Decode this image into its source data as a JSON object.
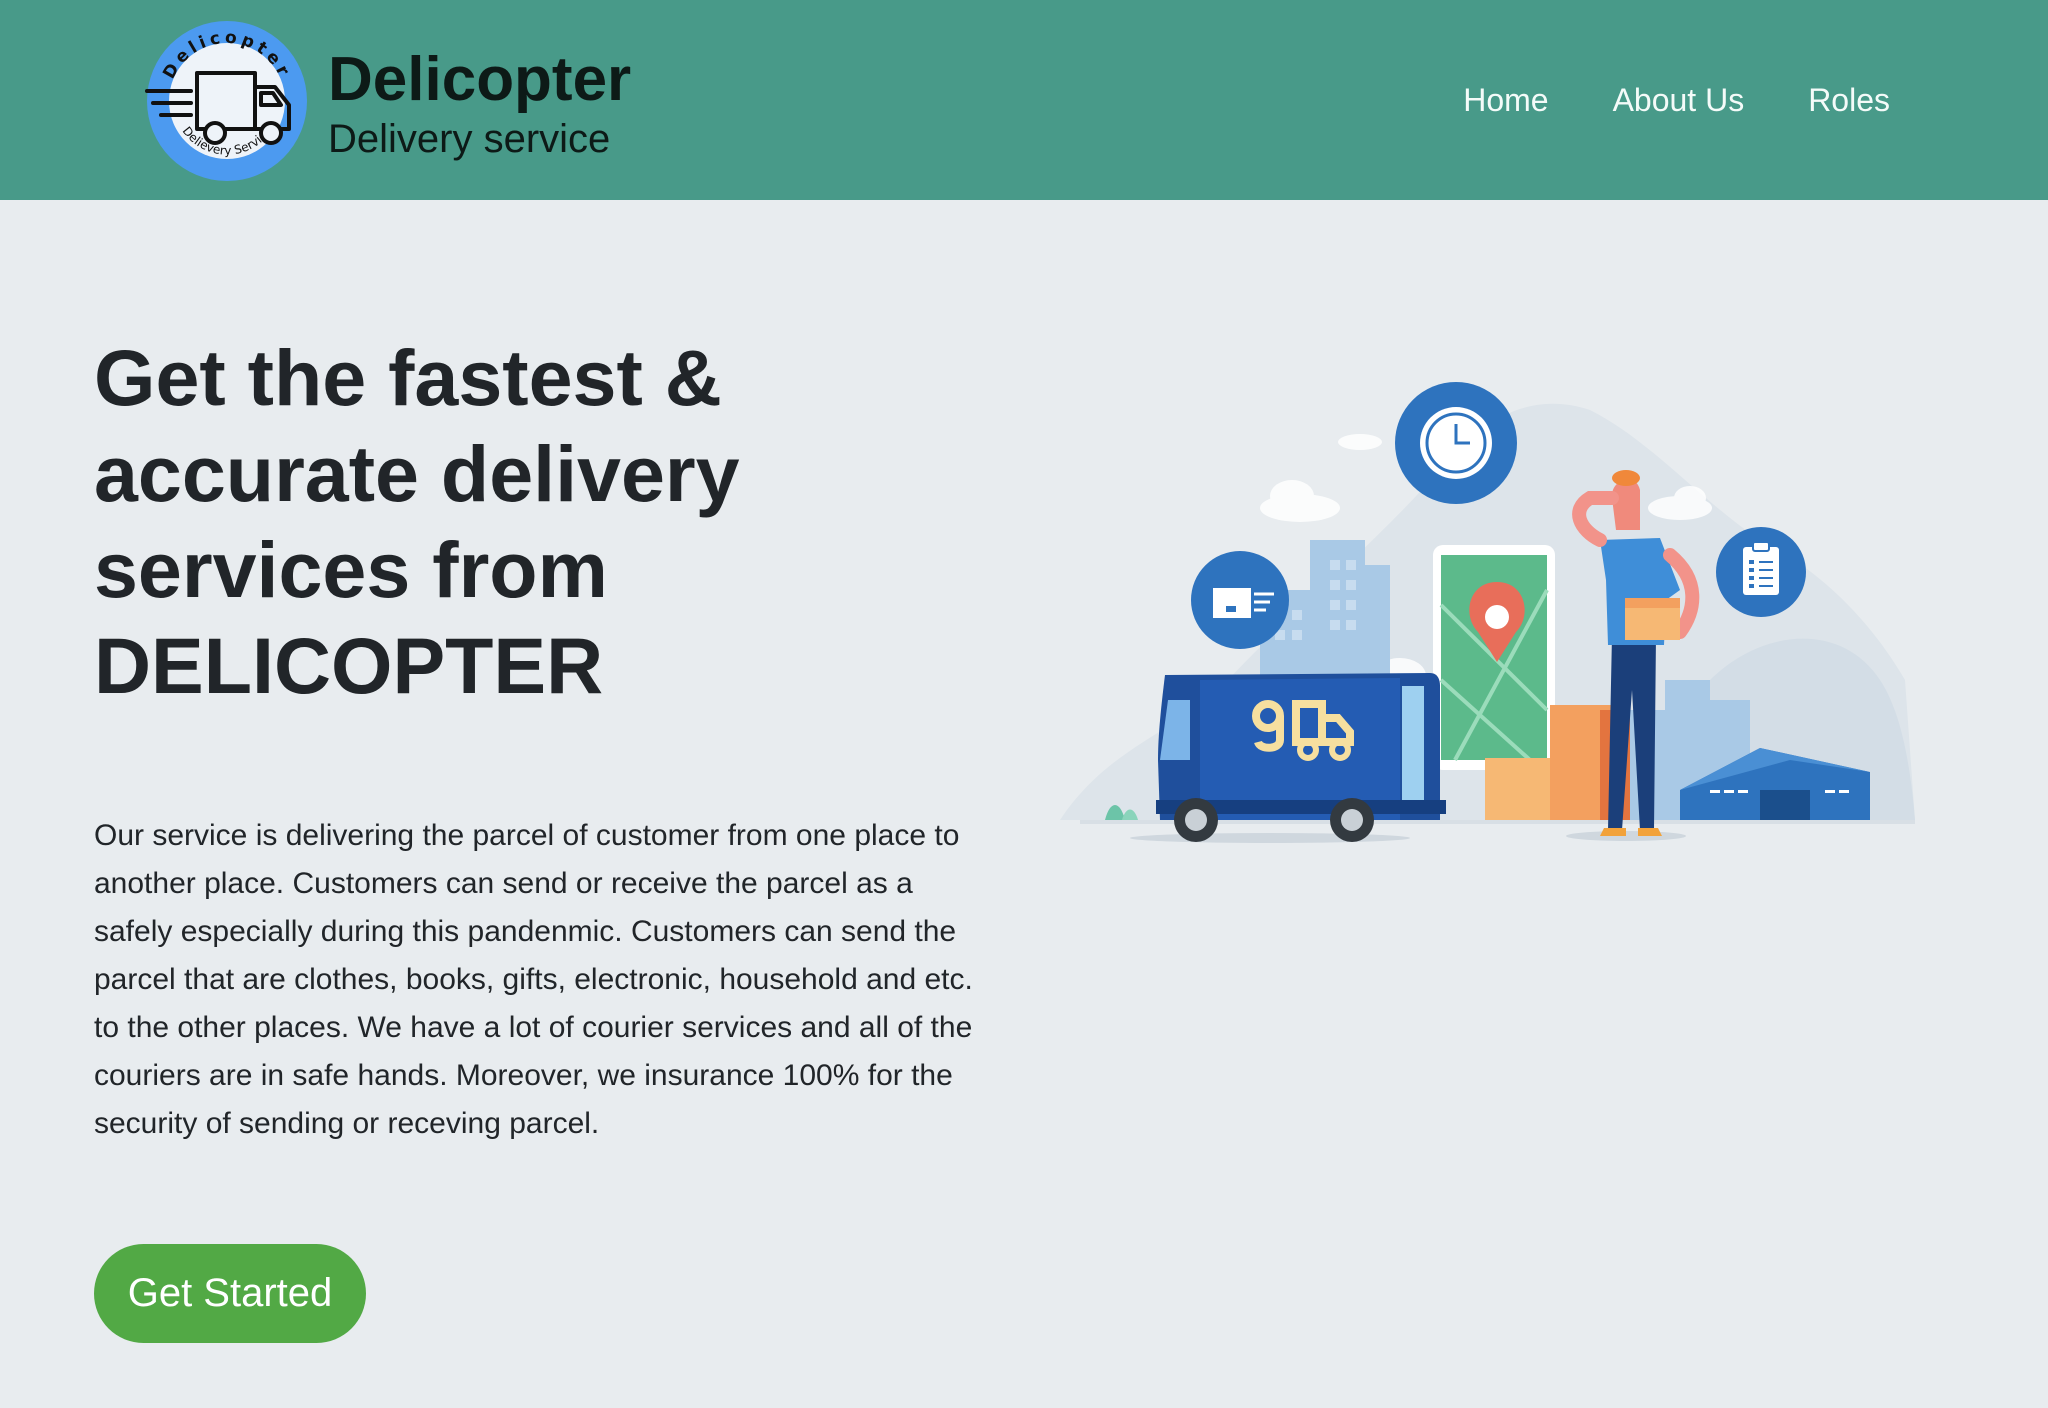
{
  "brand": {
    "name": "Delicopter",
    "tagline": "Delivery service",
    "logo_text_top": "Delicopter",
    "logo_text_bottom": "Delievery Service"
  },
  "nav": {
    "items": [
      {
        "label": "Home"
      },
      {
        "label": "About Us"
      },
      {
        "label": "Roles"
      }
    ]
  },
  "hero": {
    "title_lines": [
      "Get the fastest &",
      "accurate delivery",
      "services from",
      "DELICOPTER"
    ],
    "description": "Our service is delivering the parcel of customer from one place to another place. Customers can send or receive the parcel as a safely especially during this pandenmic. Customers can send the parcel that are clothes, books, gifts, electronic, household and etc. to the other places. We have a lot of courier services and all of the couriers are in safe hands. Moreover, we insurance 100% for the security of sending or receving parcel.",
    "cta_label": "Get Started"
  },
  "colors": {
    "navbar": "#489a89",
    "background": "#e8ecef",
    "cta": "#52a945",
    "logo_blue": "#4c9af0",
    "illustration_blue": "#2e73be"
  },
  "icons": [
    "truck-logo-icon",
    "clock-icon",
    "delivery-truck-icon",
    "clipboard-icon",
    "map-pin-icon"
  ]
}
